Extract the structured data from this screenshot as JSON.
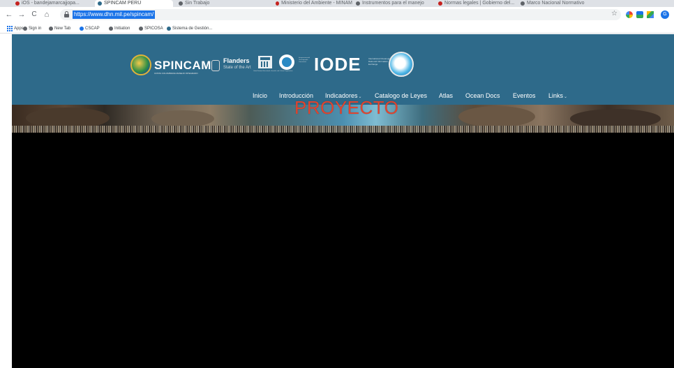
{
  "browser": {
    "tabs": [
      {
        "label": "iOS - bandejamarcajjopa...",
        "favicon_color": "#c5221f"
      },
      {
        "label": "SPINCAM PERÚ",
        "favicon_color": "#2e6a8a",
        "active": true
      },
      {
        "label": "Sin Trabajo",
        "favicon_color": "#5f6368"
      },
      {
        "label": "Ministerio del Ambiente - MINAM",
        "favicon_color": "#c5221f"
      },
      {
        "label": "Instrumentos para el manejo",
        "favicon_color": "#5f6368"
      },
      {
        "label": "Normas legales | Gobierno del...",
        "favicon_color": "#c5221f"
      },
      {
        "label": "Marco Nacional Normativo",
        "favicon_color": "#5f6368"
      }
    ],
    "url": "https://www.dhn.mil.pe/spincam/",
    "nav_icons": {
      "back": "←",
      "forward": "→",
      "reload": "C",
      "home": "⌂"
    },
    "star_icon": "☆",
    "profile_initial": "G",
    "bookmarks": [
      {
        "label": "Apps",
        "icon": "apps-grid-icon"
      },
      {
        "label": "Sign in",
        "icon": "globe-icon"
      },
      {
        "label": "New Tab",
        "icon": "globe-icon"
      },
      {
        "label": "CSCAP",
        "icon": "globe-icon"
      },
      {
        "label": "Initiation",
        "icon": "globe-icon"
      },
      {
        "label": "SPICOSA",
        "icon": "globe-icon"
      },
      {
        "label": "Sistema de Gestión...",
        "icon": "globe-icon"
      }
    ]
  },
  "site": {
    "logos": {
      "spincam": "SPINCAM",
      "spincam_sub": "COSTA COLOMBIANA MANEJO INTEGRADO",
      "flanders": "Flanders",
      "flanders_sub": "State of the Art",
      "unesco_caption": "United Nations Educational, Scientific and Cultural Organization",
      "ioc_caption": "Intergovernmental Oceanographic Commission",
      "iode": "IODE",
      "iode_sub": "International Oceanographic Data and Information Exchange"
    },
    "nav": [
      {
        "label": "Inicio",
        "has_dropdown": false
      },
      {
        "label": "Introducción",
        "has_dropdown": false
      },
      {
        "label": "Indicadores",
        "has_dropdown": true
      },
      {
        "label": "Catalogo de Leyes",
        "has_dropdown": false
      },
      {
        "label": "Atlas",
        "has_dropdown": false
      },
      {
        "label": "Ocean Docs",
        "has_dropdown": false
      },
      {
        "label": "Eventos",
        "has_dropdown": false
      },
      {
        "label": "Links",
        "has_dropdown": true
      }
    ],
    "hero_title": "PROYECTO",
    "caret": "⌄"
  },
  "colors": {
    "header_bg": "#2e6a8a",
    "hero_title": "#e0442f",
    "content_bg": "#000000"
  }
}
